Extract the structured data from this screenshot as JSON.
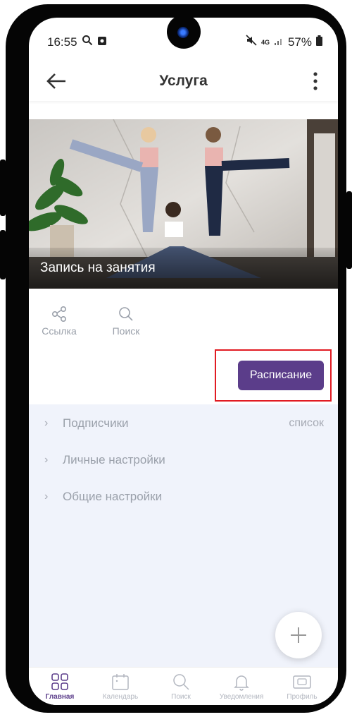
{
  "status_bar": {
    "time": "16:55",
    "network": "4G",
    "battery": "57%"
  },
  "header": {
    "title": "Услуга"
  },
  "hero": {
    "caption": "Запись на занятия"
  },
  "actions": [
    {
      "label": "Ссылка",
      "icon": "share-icon"
    },
    {
      "label": "Поиск",
      "icon": "search-icon"
    }
  ],
  "schedule_button": {
    "label": "Расписание"
  },
  "settings": [
    {
      "label": "Подписчики",
      "extra": "список"
    },
    {
      "label": "Личные настройки",
      "extra": ""
    },
    {
      "label": "Общие настройки",
      "extra": ""
    }
  ],
  "bottom_nav": [
    {
      "label": "Главная",
      "icon": "grid-icon",
      "active": true
    },
    {
      "label": "Календарь",
      "icon": "calendar-icon",
      "active": false
    },
    {
      "label": "Поиск",
      "icon": "search-icon",
      "active": false
    },
    {
      "label": "Уведомления",
      "icon": "bell-icon",
      "active": false
    },
    {
      "label": "Профиль",
      "icon": "profile-card-icon",
      "active": false
    }
  ],
  "colors": {
    "accent": "#5b3d8a",
    "highlight": "#e11b22",
    "settings_bg": "#f0f3fb"
  }
}
